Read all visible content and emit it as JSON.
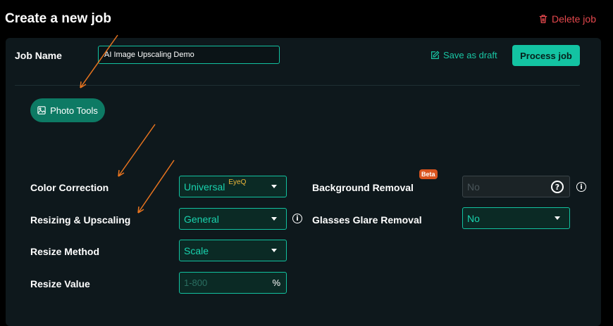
{
  "header": {
    "title": "Create a new job",
    "delete_label": "Delete job",
    "delete_icon": "trash-icon"
  },
  "job": {
    "label": "Job Name",
    "value": "AI Image Upscaling Demo",
    "save_draft_label": "Save as draft",
    "save_draft_icon": "edit-icon",
    "process_label": "Process job"
  },
  "photo_tools": {
    "label": "Photo Tools",
    "icon": "image-icon"
  },
  "fields": {
    "color_correction": {
      "label": "Color Correction",
      "value": "Universal",
      "tag": "EyeQ"
    },
    "resizing_upscaling": {
      "label": "Resizing & Upscaling",
      "value": "General",
      "info_icon": "info-icon"
    },
    "resize_method": {
      "label": "Resize Method",
      "value": "Scale"
    },
    "resize_value": {
      "label": "Resize Value",
      "placeholder": "1-800",
      "suffix": "%"
    },
    "background_removal": {
      "label": "Background Removal",
      "placeholder": "No",
      "help_icon": "help-icon",
      "info_icon": "info-icon"
    },
    "glasses_glare_removal": {
      "label": "Glasses Glare Removal",
      "badge": "Beta",
      "value": "No"
    }
  },
  "colors": {
    "accent": "#13c3a2",
    "danger": "#e5484d",
    "annotation_arrow": "#e8741f",
    "badge": "#d9541e"
  }
}
